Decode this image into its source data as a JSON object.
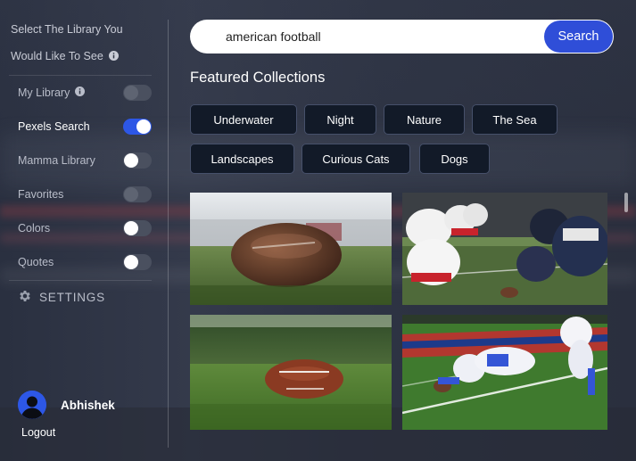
{
  "sidebar": {
    "heading_line1": "Select The Library You",
    "heading_line2": "Would Like To See",
    "items": [
      {
        "label": "My Library",
        "state": "off-dim"
      },
      {
        "label": "Pexels Search",
        "state": "on"
      },
      {
        "label": "Mamma Library",
        "state": "off"
      },
      {
        "label": "Favorites",
        "state": "off-dim"
      },
      {
        "label": "Colors",
        "state": "off"
      },
      {
        "label": "Quotes",
        "state": "off"
      }
    ],
    "settings_label": "SETTINGS",
    "user_name": "Abhishek",
    "logout_label": "Logout"
  },
  "search": {
    "value": "american football",
    "button_label": "Search"
  },
  "featured": {
    "title": "Featured Collections",
    "collections": [
      "Underwater",
      "Night",
      "Nature",
      "The Sea",
      "Landscapes",
      "Curious Cats",
      "Dogs"
    ]
  },
  "colors": {
    "accent": "#2f4ed8",
    "toggle_on": "#2d57e6",
    "chip_bg": "#121a28"
  },
  "icons": [
    "info-icon",
    "gear-icon",
    "user-avatar-icon"
  ]
}
